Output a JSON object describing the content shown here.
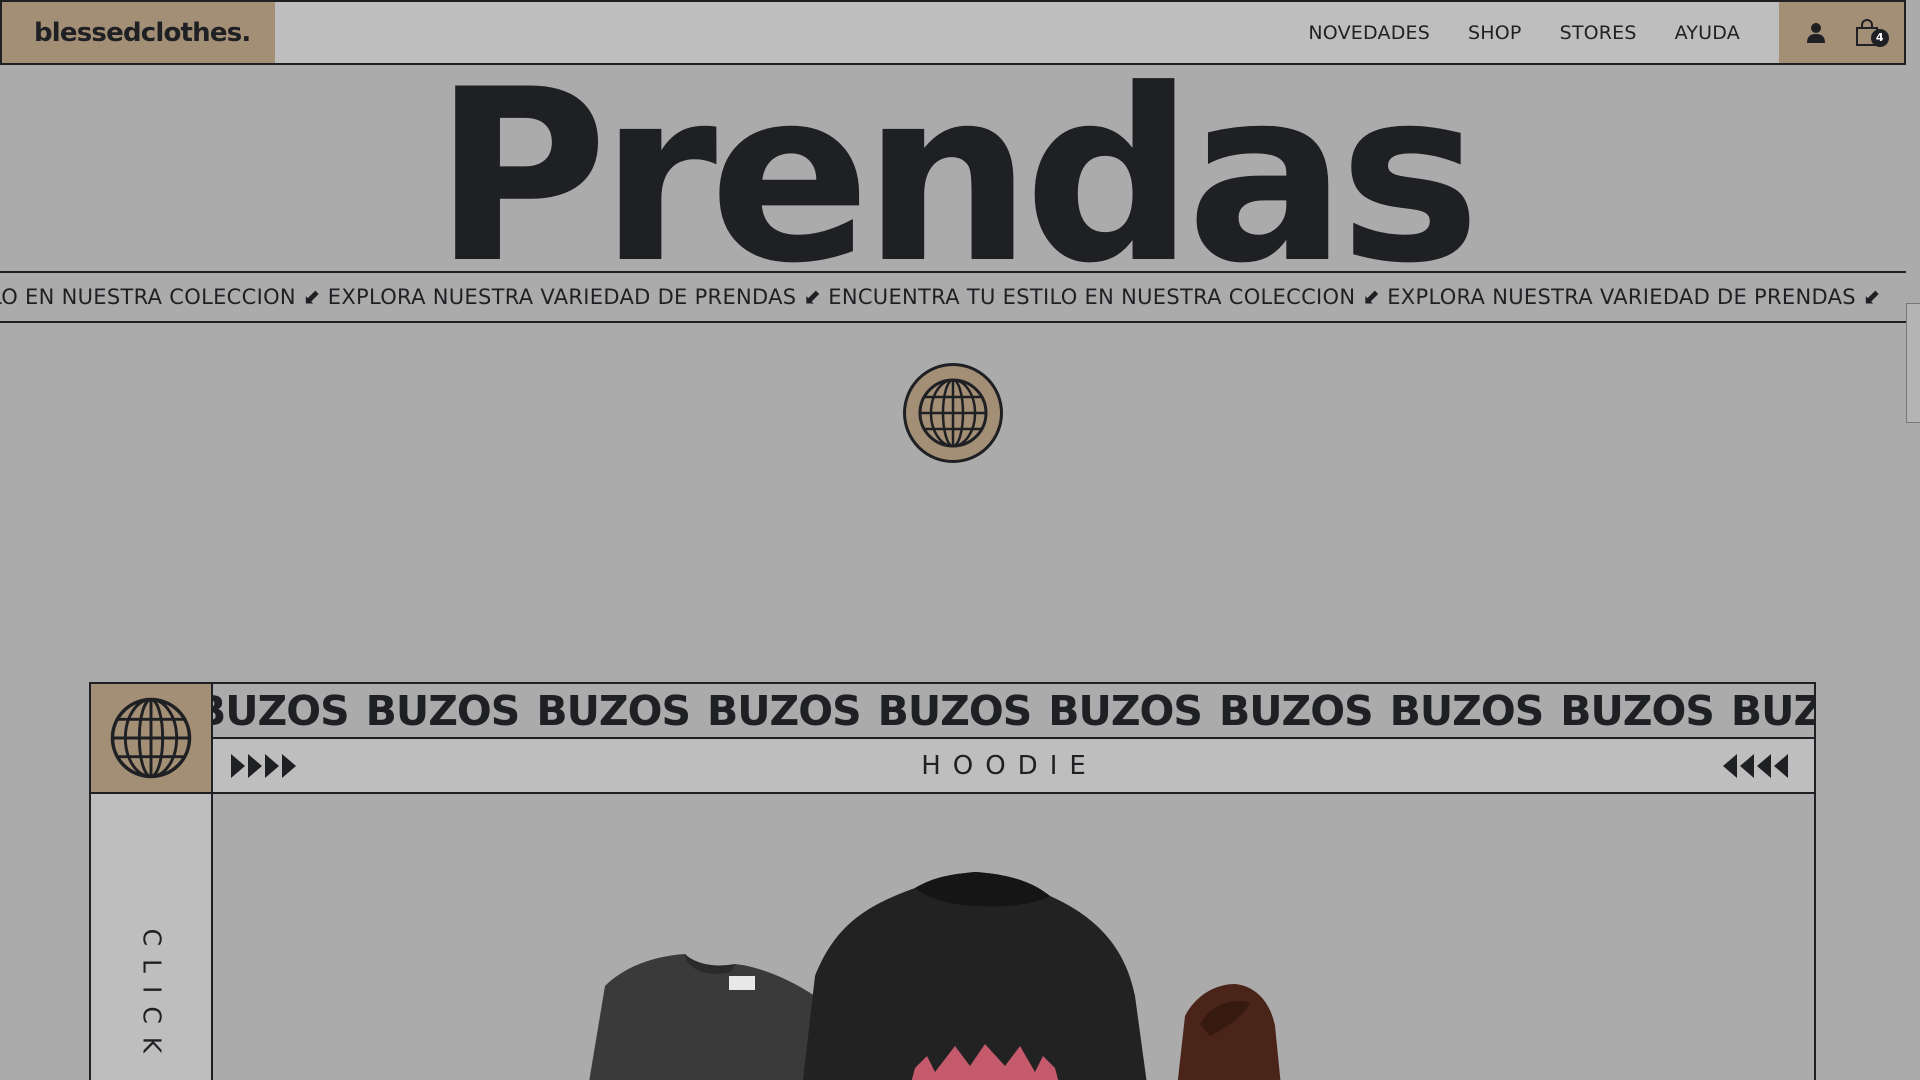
{
  "header": {
    "logo": "blessedclothes.",
    "nav": [
      "NOVEDADES",
      "SHOP",
      "STORES",
      "AYUDA"
    ],
    "icons": [
      "user-icon",
      "shopping-bag-icon"
    ],
    "cart_count": "4"
  },
  "hero": {
    "title": "Prendas",
    "ticker": "LO EN NUESTRA COLECCION ⬋ EXPLORA NUESTRA VARIEDAD DE PRENDAS ⬋ ENCUENTRA TU ESTILO EN NUESTRA COLECCION ⬋ EXPLORA NUESTRA VARIEDAD DE PRENDAS ⬋",
    "badge_icon": "globe-icon"
  },
  "product_card": {
    "category_ticker": [
      "BUZOS",
      "BUZOS",
      "BUZOS",
      "BUZOS",
      "BUZOS",
      "BUZOS",
      "BUZOS",
      "BUZOS",
      "BUZOS",
      "BUZOS",
      "B"
    ],
    "product_name": "HOODIE",
    "side_text": "CLICK T",
    "badge_icon": "globe-icon"
  },
  "colors": {
    "background": "#ababab",
    "header_bg": "#bebebe",
    "accent_tan": "#a38e76",
    "ink": "#1f2023"
  }
}
